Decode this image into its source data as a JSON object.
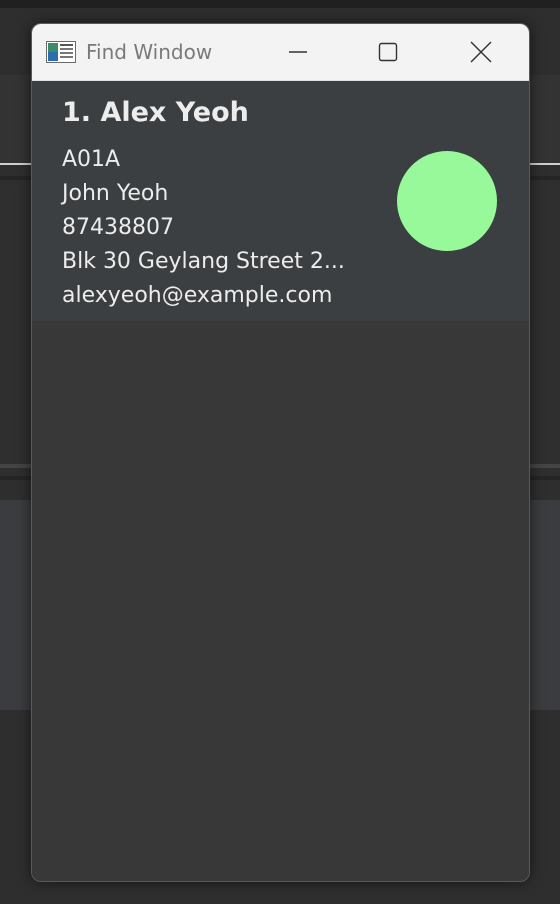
{
  "window": {
    "title": "Find Window"
  },
  "result": {
    "name": "1. Alex Yeoh",
    "fields": [
      "A01A",
      "John Yeoh",
      "87438807",
      "Blk 30 Geylang Street 2...",
      "alexyeoh@example.com"
    ],
    "avatar_color": "#98f99a"
  },
  "colors": {
    "titlebar_bg": "#f3f3f3",
    "card_bg": "#3c3f41",
    "window_bg": "#383838",
    "text": "#ececec"
  },
  "icons": {
    "app": "window-list-icon",
    "minimize": "minimize-icon",
    "maximize": "maximize-icon",
    "close": "close-icon"
  }
}
